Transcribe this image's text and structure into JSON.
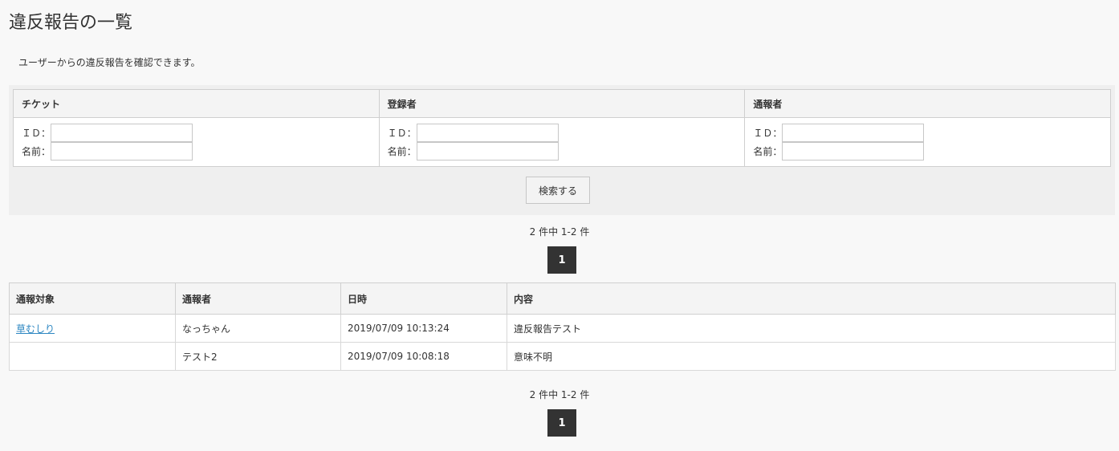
{
  "page": {
    "title": "違反報告の一覧",
    "description": "ユーザーからの違反報告を確認できます。"
  },
  "filters": {
    "columns": [
      {
        "header": "チケット",
        "id_label": "ＩＤ：",
        "name_label": "名前：",
        "id_value": "",
        "name_value": ""
      },
      {
        "header": "登録者",
        "id_label": "ＩＤ：",
        "name_label": "名前：",
        "id_value": "",
        "name_value": ""
      },
      {
        "header": "通報者",
        "id_label": "ＩＤ：",
        "name_label": "名前：",
        "id_value": "",
        "name_value": ""
      }
    ],
    "search_label": "検索する"
  },
  "pagination": {
    "count_text": "2 件中 1-2 件",
    "current_page": "1"
  },
  "reports": {
    "headers": [
      "通報対象",
      "通報者",
      "日時",
      "内容"
    ],
    "rows": [
      {
        "target": "草むしり",
        "reporter": "なっちゃん",
        "datetime": "2019/07/09 10:13:24",
        "content": "違反報告テスト"
      },
      {
        "target": "",
        "reporter": "テスト2",
        "datetime": "2019/07/09 10:08:18",
        "content": "意味不明"
      }
    ]
  },
  "colors": {
    "link": "#2d87c2",
    "pager_bg": "#333333",
    "background": "#f8f8f8"
  }
}
